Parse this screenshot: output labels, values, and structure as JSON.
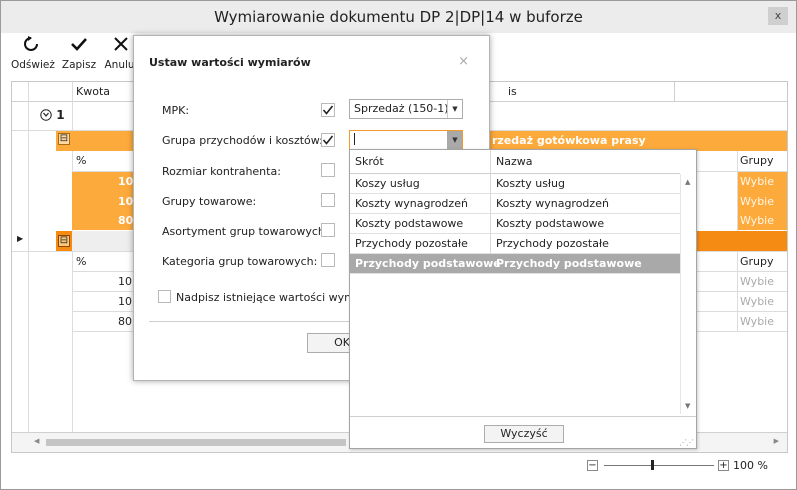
{
  "window": {
    "title": "Wymiarowanie dokumentu DP 2|DP|14 w buforze",
    "close_label": "x"
  },
  "toolbar": {
    "refresh_label": "Odśwież",
    "save_label": "Zapisz",
    "cancel_label": "Anuluj"
  },
  "grid": {
    "header_kwota": "Kwota",
    "header_opis_partial": "is",
    "group_label": "1",
    "group_row_text": "rzedaż gotówkowa prasy",
    "percent_header": "%",
    "groups_header": "Grupy",
    "block1_values": [
      "10,",
      "10,",
      "80,"
    ],
    "block2_values": [
      "10,",
      "10,",
      "80,"
    ],
    "choose_label": "Wybie",
    "expand_icon": "⊟"
  },
  "zoom": {
    "minus": "−",
    "plus": "+",
    "value": "100 %",
    "level_percent": 100
  },
  "dialog": {
    "title": "Ustaw wartości wymiarów",
    "close_symbol": "×",
    "fields": [
      {
        "label": "MPK:",
        "checked": true
      },
      {
        "label": "Grupa przychodów i kosztów:",
        "checked": true
      },
      {
        "label": "Rozmiar kontrahenta:",
        "checked": false
      },
      {
        "label": "Grupy towarowe:",
        "checked": false
      },
      {
        "label": "Asortyment grup towarowych:",
        "checked": false
      },
      {
        "label": "Kategoria grup towarowych:",
        "checked": false
      }
    ],
    "mpk_value": "Sprzedaż (150-1)",
    "group_value": "",
    "overwrite_label": "Nadpisz istniejące wartości wymiarów",
    "overwrite_checked": false,
    "ok_label": "OK"
  },
  "dropdown": {
    "col_code": "Skrót",
    "col_name": "Nazwa",
    "rows": [
      {
        "code": "Koszy usług",
        "name": "Koszty usług"
      },
      {
        "code": "Koszty wynagrodzeń",
        "name": "Koszty wynagrodzeń"
      },
      {
        "code": "Koszty podstawowe",
        "name": "Koszty podstawowe"
      },
      {
        "code": "Przychody pozostałe",
        "name": "Przychody pozostałe"
      },
      {
        "code": "Przychody podstawowe",
        "name": "Przychody podstawowe"
      }
    ],
    "selected_index": 4,
    "clear_label": "Wyczyść"
  }
}
